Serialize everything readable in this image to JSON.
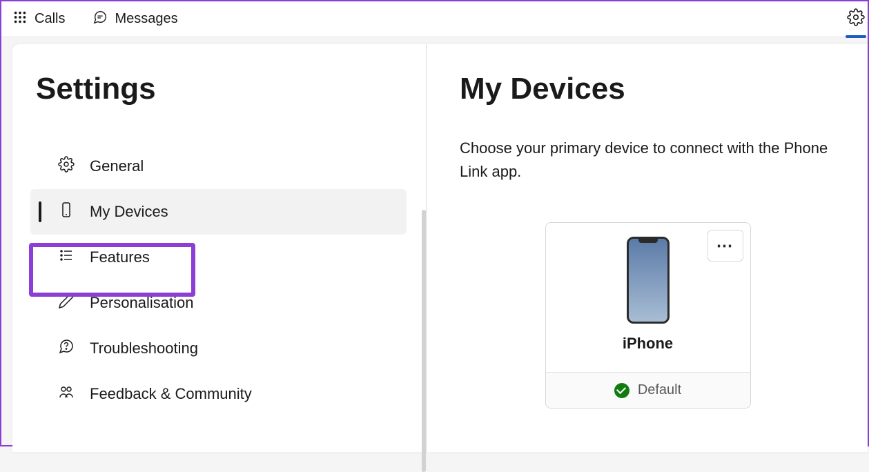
{
  "topbar": {
    "calls": "Calls",
    "messages": "Messages"
  },
  "sidebar": {
    "title": "Settings",
    "items": [
      {
        "label": "General"
      },
      {
        "label": "My Devices"
      },
      {
        "label": "Features"
      },
      {
        "label": "Personalisation"
      },
      {
        "label": "Troubleshooting"
      },
      {
        "label": "Feedback & Community"
      }
    ]
  },
  "main": {
    "title": "My Devices",
    "description": "Choose your primary device to connect with the Phone Link app.",
    "device": {
      "name": "iPhone",
      "status": "Default"
    }
  }
}
